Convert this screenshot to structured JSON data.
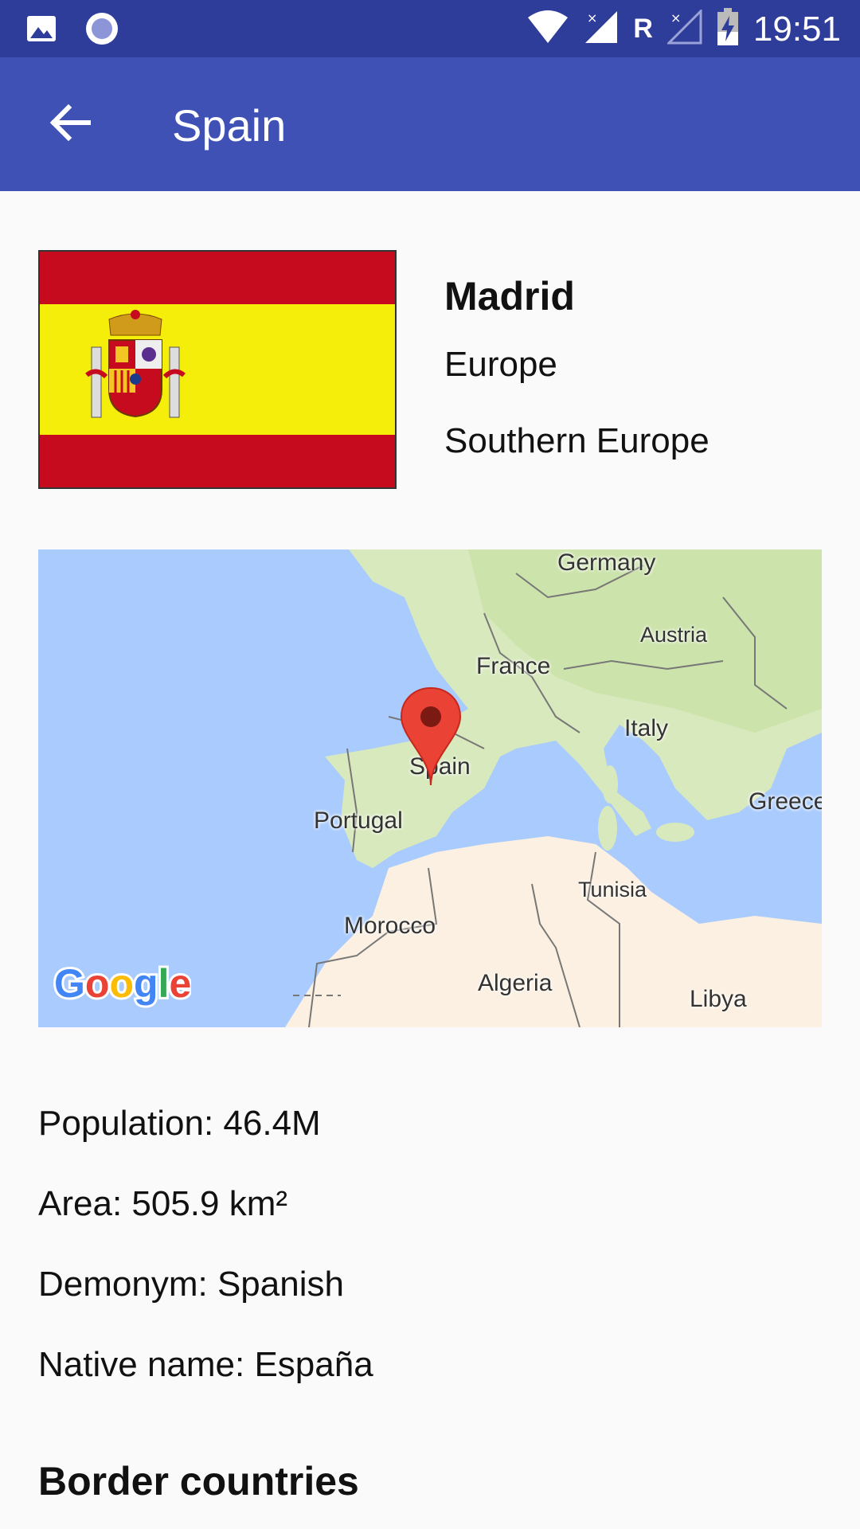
{
  "status_bar": {
    "time": "19:51",
    "roaming_label": "R",
    "icons": [
      "image-icon",
      "circle-notification-icon",
      "wifi-icon",
      "signal-icon",
      "signal-off-icon",
      "battery-charging-icon"
    ]
  },
  "toolbar": {
    "title": "Spain",
    "back_icon": "arrow-back-icon",
    "color": "#3f51b5"
  },
  "country": {
    "capital": "Madrid",
    "region": "Europe",
    "subregion": "Southern Europe",
    "flag_colors": [
      "#c60b1e",
      "#ffc400",
      "#c60b1e"
    ]
  },
  "map": {
    "labels": {
      "germany": "Germany",
      "austria": "Austria",
      "france": "France",
      "italy": "Italy",
      "spain": "Spain",
      "portugal": "Portugal",
      "greece": "Greece",
      "tunisia": "Tunisia",
      "morocco": "Morocco",
      "algeria": "Algeria",
      "libya": "Libya"
    },
    "attribution": "Google"
  },
  "stats": {
    "population": "Population: 46.4M",
    "area": "Area: 505.9 km²",
    "demonym": "Demonym: Spanish",
    "native_name": "Native name: España"
  },
  "sections": {
    "border_countries": "Border countries"
  }
}
